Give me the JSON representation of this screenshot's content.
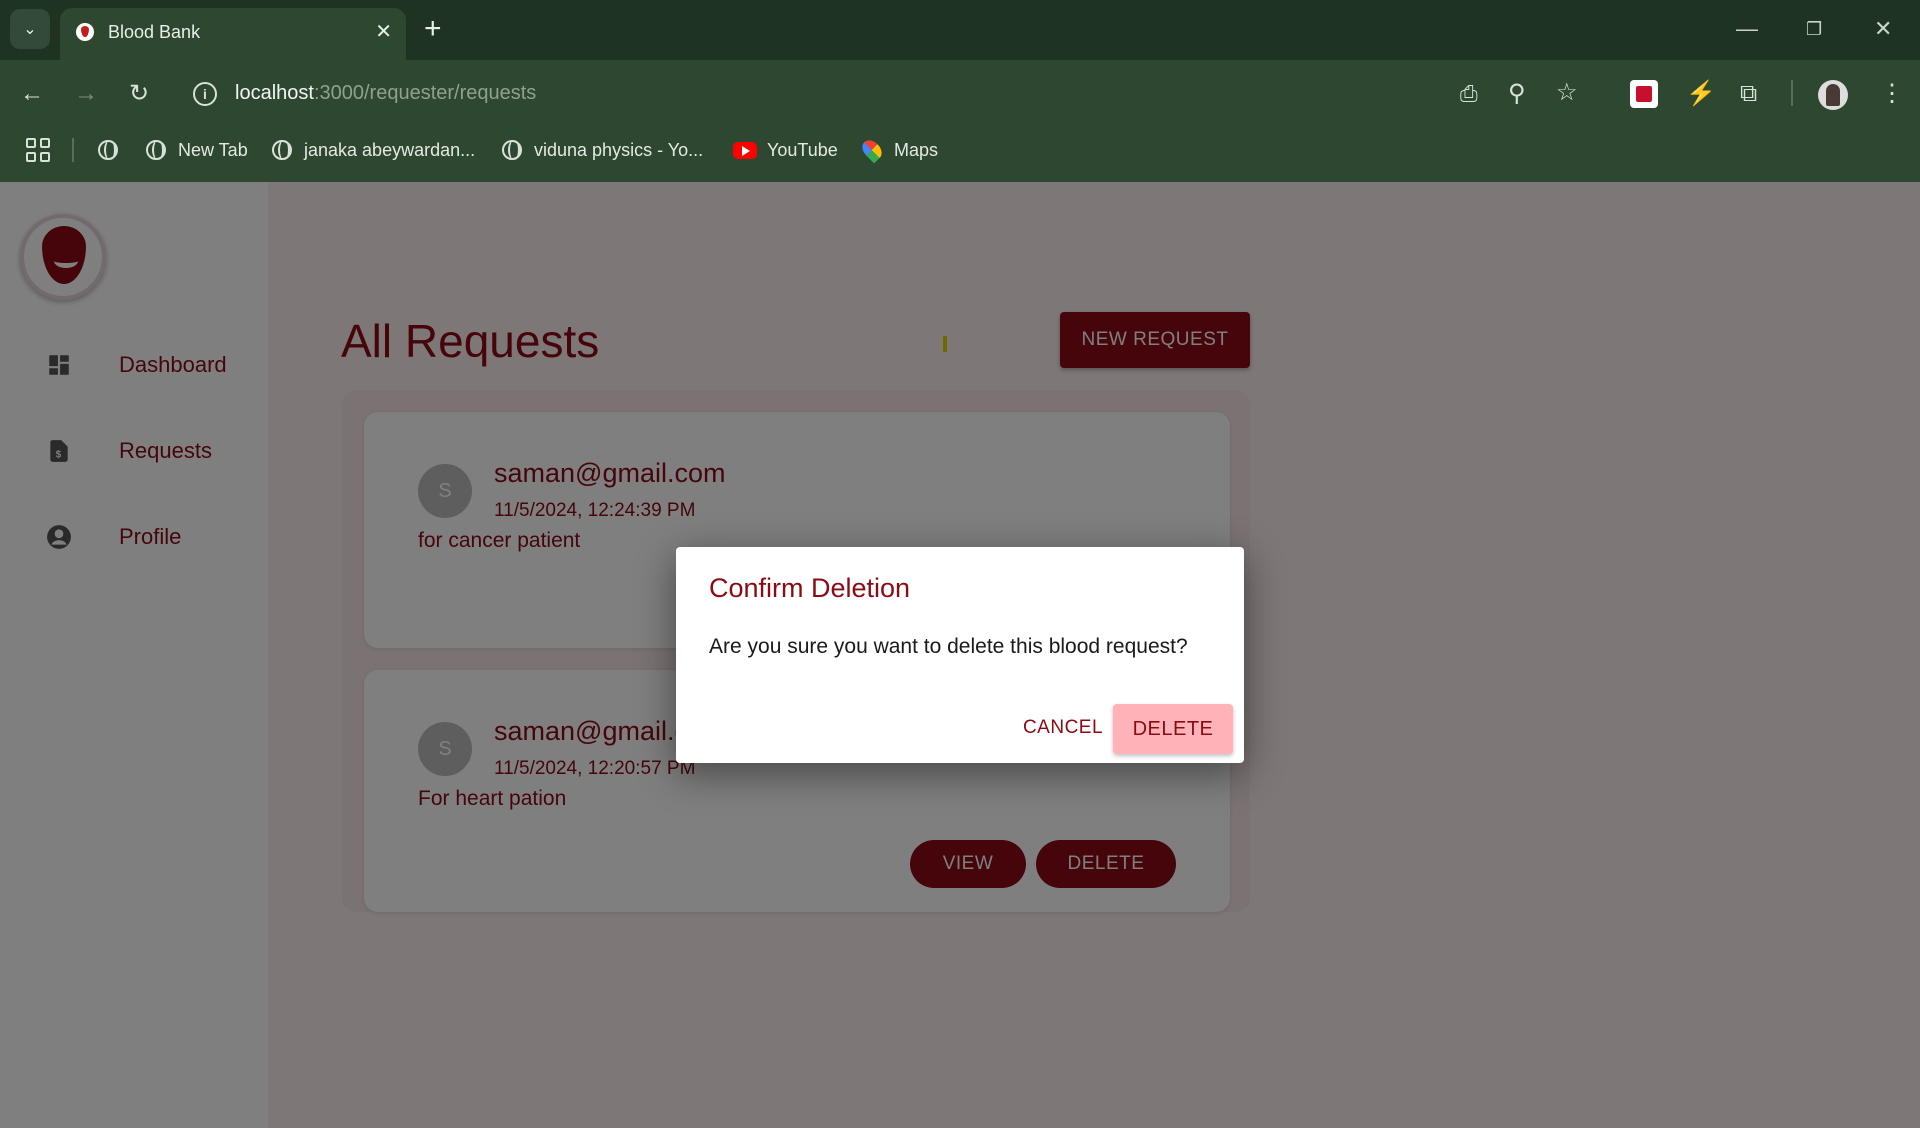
{
  "browser": {
    "tab_title": "Blood Bank",
    "url_host": "localhost",
    "url_path": ":3000/requester/requests",
    "bookmarks": [
      {
        "label": "New Tab",
        "icon": "globe-icon"
      },
      {
        "label": "janaka abeywardan...",
        "icon": "globe-icon"
      },
      {
        "label": "viduna physics - Yo...",
        "icon": "globe-icon"
      },
      {
        "label": "YouTube",
        "icon": "youtube-icon"
      },
      {
        "label": "Maps",
        "icon": "maps-icon"
      }
    ]
  },
  "sidebar": {
    "items": [
      {
        "label": "Dashboard",
        "icon": "dashboard-icon"
      },
      {
        "label": "Requests",
        "icon": "document-icon"
      },
      {
        "label": "Profile",
        "icon": "account-circle-icon"
      }
    ]
  },
  "main": {
    "title": "All Requests",
    "new_request_label": "NEW REQUEST",
    "requests": [
      {
        "avatar": "S",
        "email": "saman@gmail.com",
        "date": "11/5/2024, 12:24:39 PM",
        "reason": "for cancer patient"
      },
      {
        "avatar": "S",
        "email": "saman@gmail.com",
        "date": "11/5/2024, 12:20:57 PM",
        "reason": "For heart pation",
        "view_label": "VIEW",
        "delete_label": "DELETE"
      }
    ]
  },
  "dialog": {
    "title": "Confirm Deletion",
    "message": "Are you sure you want to delete this blood request?",
    "cancel_label": "CANCEL",
    "delete_label": "DELETE"
  },
  "colors": {
    "brand": "#8b0a14",
    "delete_button_bg": "#ffb3b8",
    "chrome_bg": "#2e4731"
  }
}
